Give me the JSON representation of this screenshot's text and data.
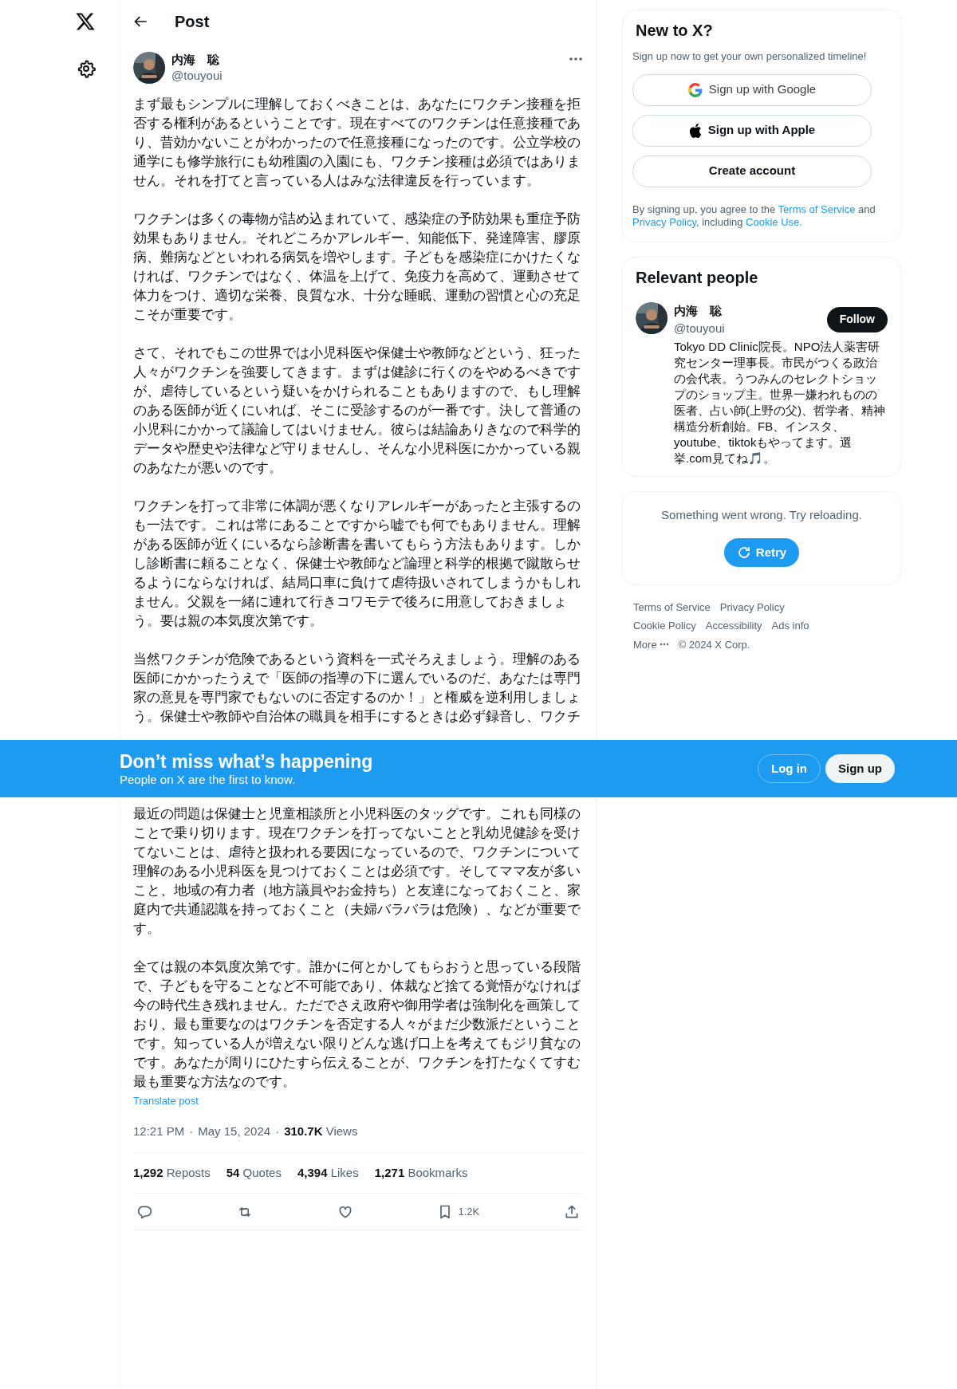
{
  "header": {
    "title": "Post"
  },
  "post": {
    "author": {
      "name": "内海　聡",
      "handle": "@touyoui"
    },
    "text_before_banner": [
      "まず最もシンプルに理解しておくべきことは、あなたにワクチン接種を拒否する権利があるということです。現在すべてのワクチンは任意接種であり、昔効かないことがわかったので任意接種になったのです。公立学校の通学にも修学旅行にも幼稚園の入園にも、ワクチン接種は必須ではありません。それを打てと言っている人はみな法律違反を行っています。",
      "ワクチンは多くの毒物が詰め込まれていて、感染症の予防効果も重症予防効果もありません。それどころかアレルギー、知能低下、発達障害、膠原病、難病などといわれる病気を増やします。子どもを感染症にかけたくなければ、ワクチンではなく、体温を上げて、免疫力を高めて、運動させて体力をつけ、適切な栄養、良質な水、十分な睡眠、運動の習慣と心の充足こそが重要です。",
      "さて、それでもこの世界では小児科医や保健士や教師などという、狂った人々がワクチンを強要してきます。まずは健診に行くのをやめるべきですが、虐待しているという疑いをかけられることもありますので、もし理解のある医師が近くにいれば、そこに受診するのが一番です。決して普通の小児科にかかって議論してはいけません。彼らは結論ありきなので科学的データや歴史や法律など守りませんし、そんな小児科医にかかっている親のあなたが悪いのです。",
      "ワクチンを打って非常に体調が悪くなりアレルギーがあったと主張するのも一法です。これは常にあることですから嘘でも何でもありません。理解がある医師が近くにいるなら診断書を書いてもらう方法もあります。しかし診断書に頼ることなく、保健士や教師など論理と科学的根拠で蹴散らせるようにならなければ、結局口車に負けて虐待扱いされてしまうかもしれません。父親を一緒に連れて行きコワモテで後ろに用意しておきましょう。要は親の本気度次第です。",
      "当然ワクチンが危険であるという資料を一式そろえましょう。理解のある医師にかかったうえで「医師の指導の下に選んでいるのだ、あなたは専門家の意見を専門家でもないのに否定するのか！」と権威を逆利用しましょう。保健士や教師や自治体の職員を相手にするときは必ず録音し、ワクチ"
    ],
    "text_after_banner": [
      "最近の問題は保健士と児童相談所と小児科医のタッグです。これも同様のことで乗り切ります。現在ワクチンを打ってないことと乳幼児健診を受けてないことは、虐待と扱われる要因になっているので、ワクチンについて理解のある小児科医を見つけておくことは必須です。そしてママ友が多いこと、地域の有力者（地方議員やお金持ち）と友達になっておくこと、家庭内で共通認識を持っておくこと（夫婦バラバラは危険）、などが重要です。",
      "全ては親の本気度次第です。誰かに何とかしてもらおうと思っている段階で、子どもを守ることなど不可能であり、体裁など捨てる覚悟がなければ今の時代生き残れません。ただでさえ政府や御用学者は強制化を画策しており、最も重要なのはワクチンを否定する人々がまだ少数派だということです。知っている人が増えない限りどんな逃げ口上を考えてもジリ貧なのです。あなたが周りにひたすら伝えることが、ワクチンを打たなくてすむ最も重要な方法なのです。"
    ],
    "translate_link": "Translate post",
    "time": "12:21 PM",
    "separator": "·",
    "date": "May 15, 2024",
    "views": "**310.7K** Views",
    "stats": [
      "**1,292** Reposts",
      "**54** Quotes",
      "**4,394** Likes",
      "**1,271** Bookmarks"
    ],
    "actions": [
      {
        "kind": "reply"
      },
      {
        "kind": "repost"
      },
      {
        "kind": "like"
      },
      {
        "kind": "bookmark",
        "count": "1.2K"
      },
      {
        "kind": "share"
      }
    ]
  },
  "signup_card": {
    "title": "New to X?",
    "subtitle": "Sign up now to get your own personalized timeline!",
    "buttons": [
      {
        "kind": "google",
        "label": "Sign up with Google"
      },
      {
        "kind": "apple",
        "label": "Sign up with Apple"
      },
      {
        "kind": "create",
        "label": "Create account"
      }
    ],
    "legal": [
      {
        "text": "By signing up, you agree to the ",
        "link": false
      },
      {
        "text": "Terms of Service",
        "link": true
      },
      {
        "text": " and ",
        "link": false
      },
      {
        "text": "Privacy Policy",
        "link": true
      },
      {
        "text": ", including ",
        "link": false
      },
      {
        "text": "Cookie Use.",
        "link": true
      }
    ]
  },
  "relevant_people": {
    "title": "Relevant people",
    "person": {
      "name": "内海　聡",
      "handle": "@touyoui",
      "follow_label": "Follow",
      "bio": "Tokyo DD Clinic院長。NPO法人薬害研究センター理事長。市民がつくる政治の会代表。うつみんのセレクトショップのショップ主。世界一嫌われものの医者、占い師(上野の父)、哲学者、精神構造分析創始。FB、インスタ、youtube、tiktokもやってます。選挙.com見てね🎵。"
    }
  },
  "error_card": {
    "message": "Something went wrong. Try reloading.",
    "retry_label": "Retry"
  },
  "footer_links": [
    "Terms of Service",
    "Privacy Policy",
    "Cookie Policy",
    "Accessibility",
    "Ads info",
    "More",
    "© 2024 X Corp."
  ],
  "banner": {
    "title": "Don’t miss what’s happening",
    "subtitle": "People on X are the first to know.",
    "login_label": "Log in",
    "signup_label": "Sign up"
  }
}
